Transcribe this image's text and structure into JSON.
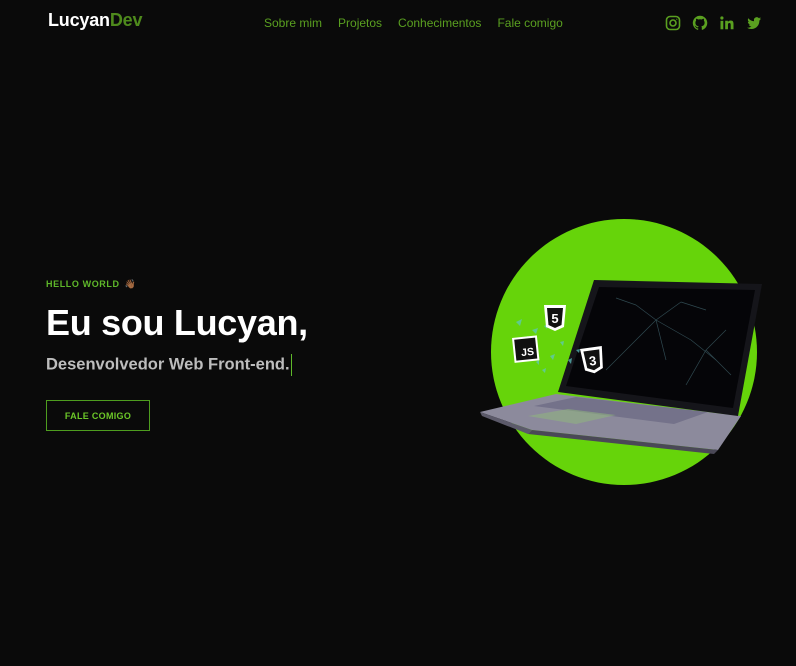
{
  "brand": {
    "part1": "Lucyan",
    "part2": "Dev",
    "accent": "#4e8a1c"
  },
  "nav": {
    "items": [
      {
        "label": "Sobre mim"
      },
      {
        "label": "Projetos"
      },
      {
        "label": "Conhecimentos"
      },
      {
        "label": "Fale comigo"
      }
    ]
  },
  "social": {
    "icons": [
      "instagram-icon",
      "github-icon",
      "linkedin-icon",
      "twitter-icon"
    ],
    "color": "#5aa020"
  },
  "hero": {
    "eyebrow": "HELLO WORLD",
    "eyebrow_emoji": "👋🏾",
    "title": "Eu sou Lucyan,",
    "subtitle": "Desenvolvedor Web Front-end.",
    "cta_label": "FALE COMIGO"
  },
  "illustration": {
    "badges": [
      "5",
      "JS",
      "3"
    ],
    "circle_color": "#66d40a"
  }
}
